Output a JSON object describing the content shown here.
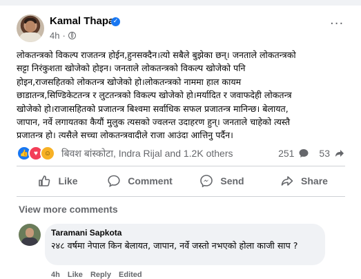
{
  "post": {
    "author": "Kamal Thapa",
    "time": "4h",
    "separator": "·",
    "more_label": "···",
    "text_lines": [
      "लोकतन्त्रको विकल्प राजतन्त्र होईन,हुनसक्दैन।त्यो सबैले बुझेका छन्। जनताले लोकतन्त्रको",
      "सट्टा निरंकुशता खोजेको होइन। जनताले लोकतन्त्रको विकल्प खोजेको पनि",
      "होइन,राजसहितको लोकतन्त्र खोजेको हो।लोकतन्त्रको नाममा हाल कायम",
      "छाडातन्त्र,सिण्डिकेटतन्त्र र लुटतन्त्रको विकल्प खोजेको हो।मर्यादित र जवाफदेही लोकतन्त्र",
      "खोजेको हो।राजासहितको प्रजातन्त्र बिश्वमा सर्वाधिक सफल प्रजातन्त्र मानिन्छ। बेलायत,",
      "जापान, नर्वे लगायतका कैयौं मुलुक त्यसको ज्वलन्त उदाहरण हुन्। जनताले चाहेको त्यस्तै",
      "प्रजातन्त्र हो। त्यसैले सच्चा लोकतन्त्रवादीले राजा आउंदा आत्तिनु पर्दैन।"
    ]
  },
  "reactions": {
    "icons": [
      "like-icon",
      "love-icon",
      "haha-icon"
    ],
    "reactors": "बिवश बांस्कोटा, Indra Rijal and 1.2K others",
    "comments_count": "251",
    "shares_count": "53"
  },
  "actions": {
    "like": "Like",
    "comment": "Comment",
    "send": "Send",
    "share": "Share"
  },
  "comments": {
    "view_more": "View more comments",
    "first": {
      "name": "Taramani Sapkota",
      "text": "२४८ वर्षमा नेपाल किन बेलायत, जापान, नर्वे जस्तो नभएको होला काजी साप ?",
      "age": "4h",
      "like_label": "Like",
      "reply_label": "Reply",
      "edited_label": "Edited"
    }
  },
  "colors": {
    "accent": "#1877f2",
    "secondary_text": "#65676b",
    "love": "#f33e58",
    "haha": "#f7b125",
    "bubble_bg": "#f0f2f5"
  }
}
